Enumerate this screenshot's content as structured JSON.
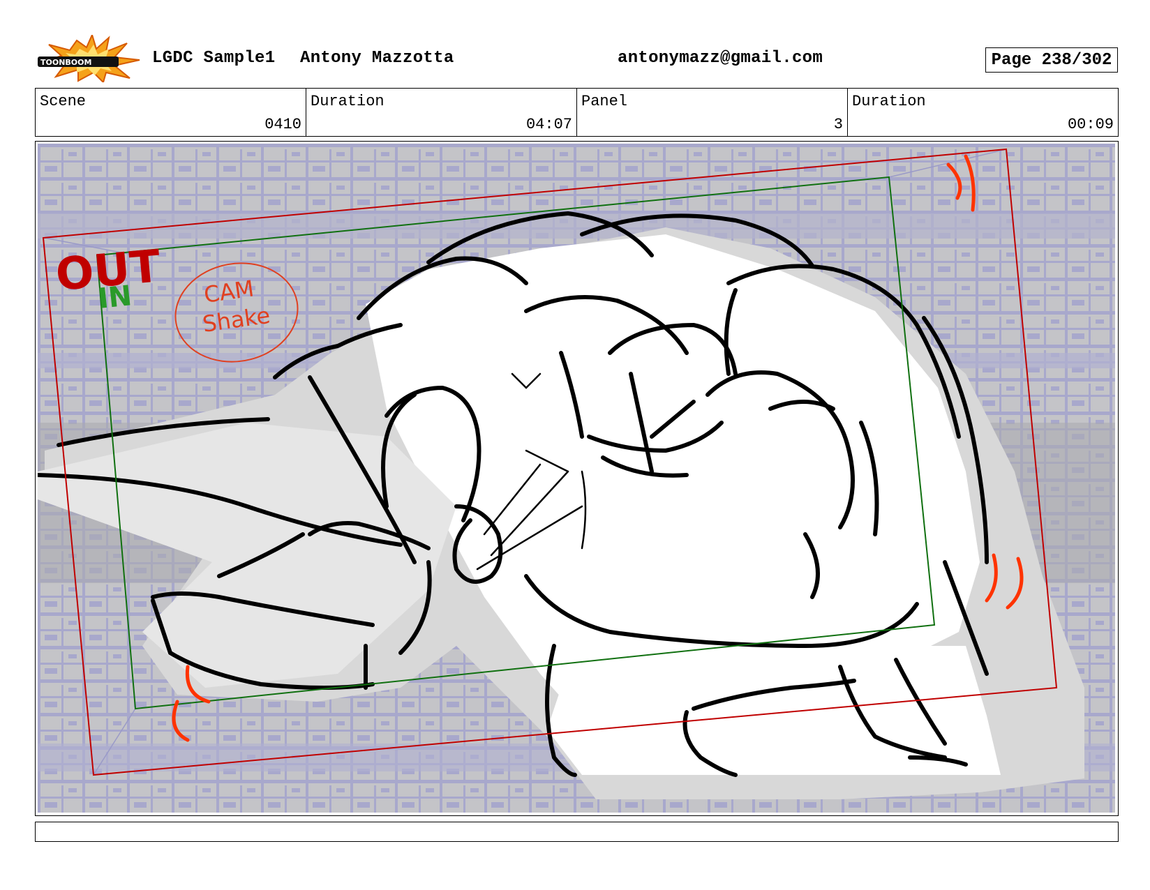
{
  "header": {
    "logo_text": "TOONBOOM",
    "project": "LGDC Sample1",
    "author": "Antony Mazzotta",
    "email": "antonymazz@gmail.com",
    "page": "Page 238/302"
  },
  "info": {
    "scene_label": "Scene",
    "scene_value": "0410",
    "scene_duration_label": "Duration",
    "scene_duration_value": "04:07",
    "panel_label": "Panel",
    "panel_value": "3",
    "panel_duration_label": "Duration",
    "panel_duration_value": "00:09"
  },
  "panel": {
    "out_label": "OUT",
    "in_label": "IN",
    "note_line1": "CAM",
    "note_line2": "Shake"
  },
  "colors": {
    "out_frame": "#c00000",
    "in_frame": "#107010",
    "note": "#e04020",
    "background_grid": "#a8a8cc"
  },
  "notes_text": ""
}
